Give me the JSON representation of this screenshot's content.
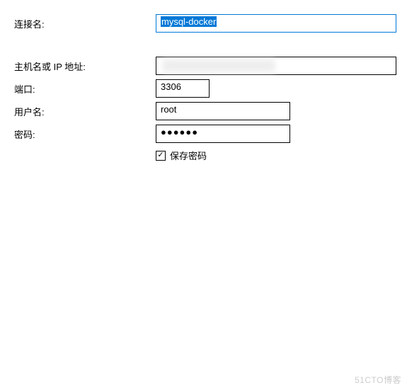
{
  "labels": {
    "connection_name": "连接名:",
    "host": "主机名或 IP 地址:",
    "port": "端口:",
    "username": "用户名:",
    "password": "密码:",
    "save_password": "保存密码"
  },
  "values": {
    "connection_name": "mysql-docker",
    "host": "",
    "port": "3306",
    "username": "root",
    "password_mask": "●●●●●●",
    "save_password_checked": true
  },
  "watermark": "51CTO博客"
}
